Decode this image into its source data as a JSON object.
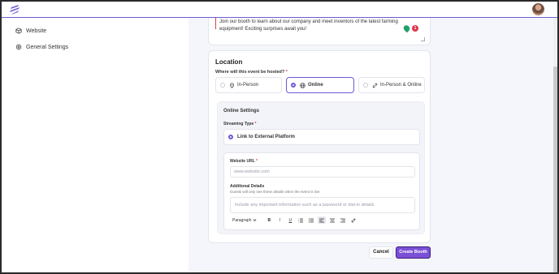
{
  "sidebar": {
    "items": [
      {
        "label": "Website",
        "icon": "cube-icon"
      },
      {
        "label": "General Settings",
        "icon": "gear-icon"
      }
    ]
  },
  "description": {
    "text": "Join our booth to learn about our company and meet inventors of the latest farming equipment! Exciting surprises await you!",
    "badge_count": "1"
  },
  "location": {
    "title": "Location",
    "question": "Where will this event be hosted?",
    "required_mark": "*",
    "options": [
      {
        "label": "In-Person",
        "icon": "map-pin-icon",
        "selected": false
      },
      {
        "label": "Online",
        "icon": "globe-icon",
        "selected": true
      },
      {
        "label": "In-Person & Online",
        "icon": "link-icon",
        "selected": false
      }
    ]
  },
  "online_settings": {
    "title": "Online Settings",
    "streaming_type_label": "Streaming Type",
    "streaming_option": "Link to External Platform",
    "website_url_label": "Website URL",
    "website_url_placeholder": "www.website.com",
    "additional_label": "Additional Details",
    "additional_help": "Guests will only see these details when the event is live",
    "additional_placeholder": "Include any important information such as a password or dial-in details",
    "toolbar": {
      "paragraph": "Paragraph",
      "bold": "B",
      "italic": "I",
      "underline": "U"
    }
  },
  "actions": {
    "cancel": "Cancel",
    "create": "Create Booth"
  },
  "colors": {
    "accent": "#6b5bd6",
    "primary_button": "#7b4fd6",
    "required": "#d64545"
  }
}
